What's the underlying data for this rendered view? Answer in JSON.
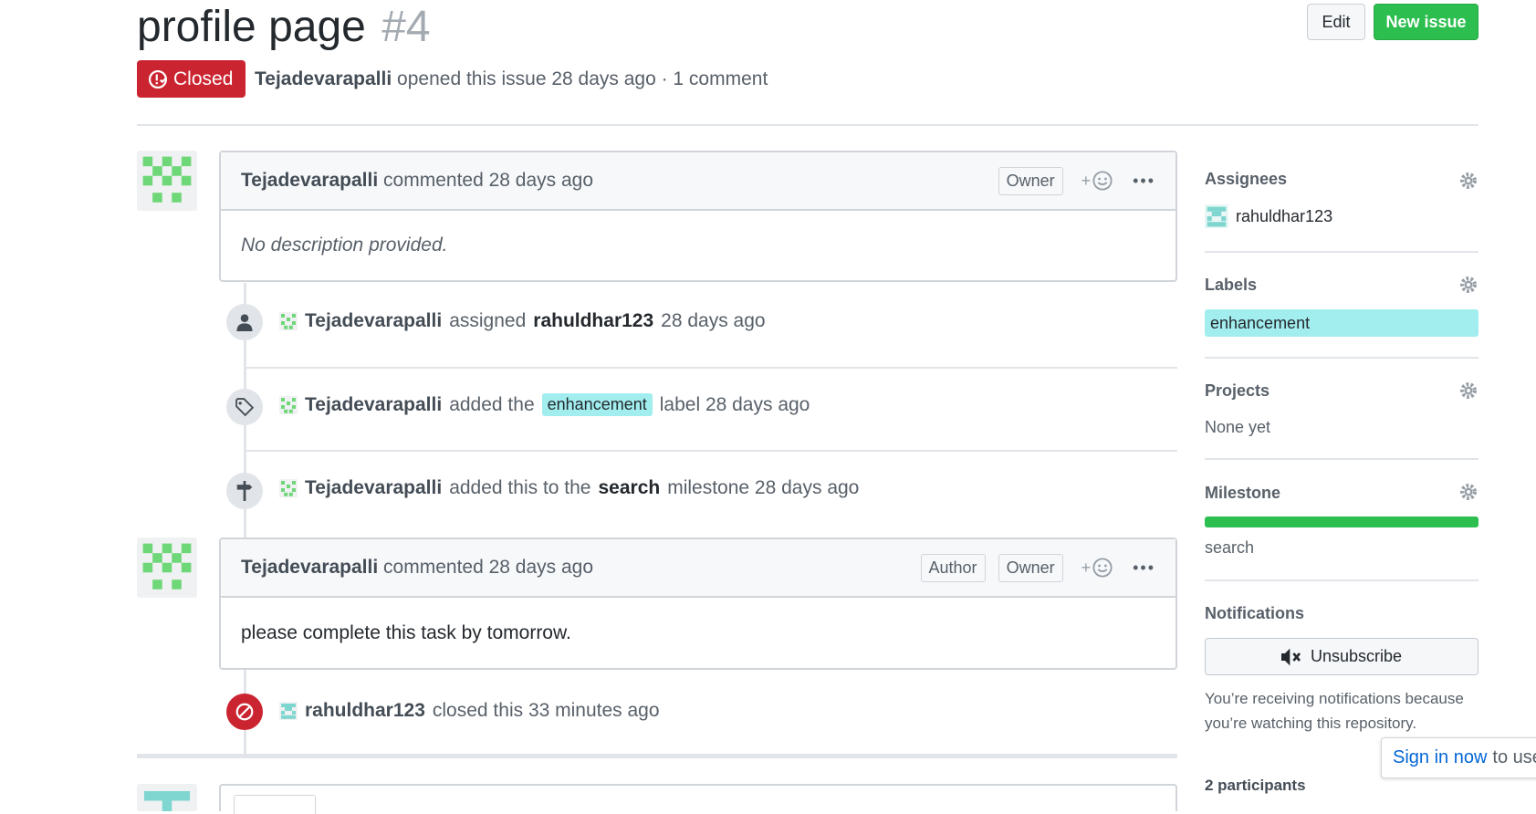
{
  "issue": {
    "title": "profile page",
    "number": "#4",
    "state": "Closed",
    "author": "Tejadevarapalli",
    "meta_text": "opened this issue 28 days ago · 1 comment"
  },
  "header_actions": {
    "edit_label": "Edit",
    "new_issue_label": "New issue"
  },
  "comments": [
    {
      "author": "Tejadevarapalli",
      "action": "commented 28 days ago",
      "badges": [
        "Owner"
      ],
      "body": "No description provided."
    },
    {
      "author": "Tejadevarapalli",
      "action": "commented 28 days ago",
      "badges": [
        "Author",
        "Owner"
      ],
      "body": "please complete this task by tomorrow."
    }
  ],
  "timeline": {
    "assigned": {
      "actor": "Tejadevarapalli",
      "verb": "assigned",
      "target": "rahuldhar123",
      "time": "28 days ago"
    },
    "labeled": {
      "actor": "Tejadevarapalli",
      "verb": "added the",
      "label": "enhancement",
      "suffix": "label 28 days ago"
    },
    "milestoned": {
      "actor": "Tejadevarapalli",
      "verb": "added this to the",
      "milestone": "search",
      "suffix": "milestone 28 days ago"
    },
    "closed": {
      "actor": "rahuldhar123",
      "text": "closed this 33 minutes ago"
    }
  },
  "sidebar": {
    "assignees": {
      "title": "Assignees",
      "user": "rahuldhar123"
    },
    "labels": {
      "title": "Labels",
      "label": "enhancement",
      "label_color": "#a2eeef"
    },
    "projects": {
      "title": "Projects",
      "value": "None yet"
    },
    "milestone": {
      "title": "Milestone",
      "name": "search",
      "progress_percent": 100,
      "bar_color": "#2cbe4e"
    },
    "notifications": {
      "title": "Notifications",
      "button_label": "Unsubscribe",
      "reason_line1": "You’re receiving notifications because",
      "reason_line2": "you’re watching this repository."
    },
    "participants": "2 participants"
  },
  "tooltip": {
    "link": "Sign in now",
    "text": "to use"
  },
  "colors": {
    "closed_red": "#cb2431",
    "new_issue_green": "#2cbe4e",
    "label_cyan": "#a2eeef"
  }
}
